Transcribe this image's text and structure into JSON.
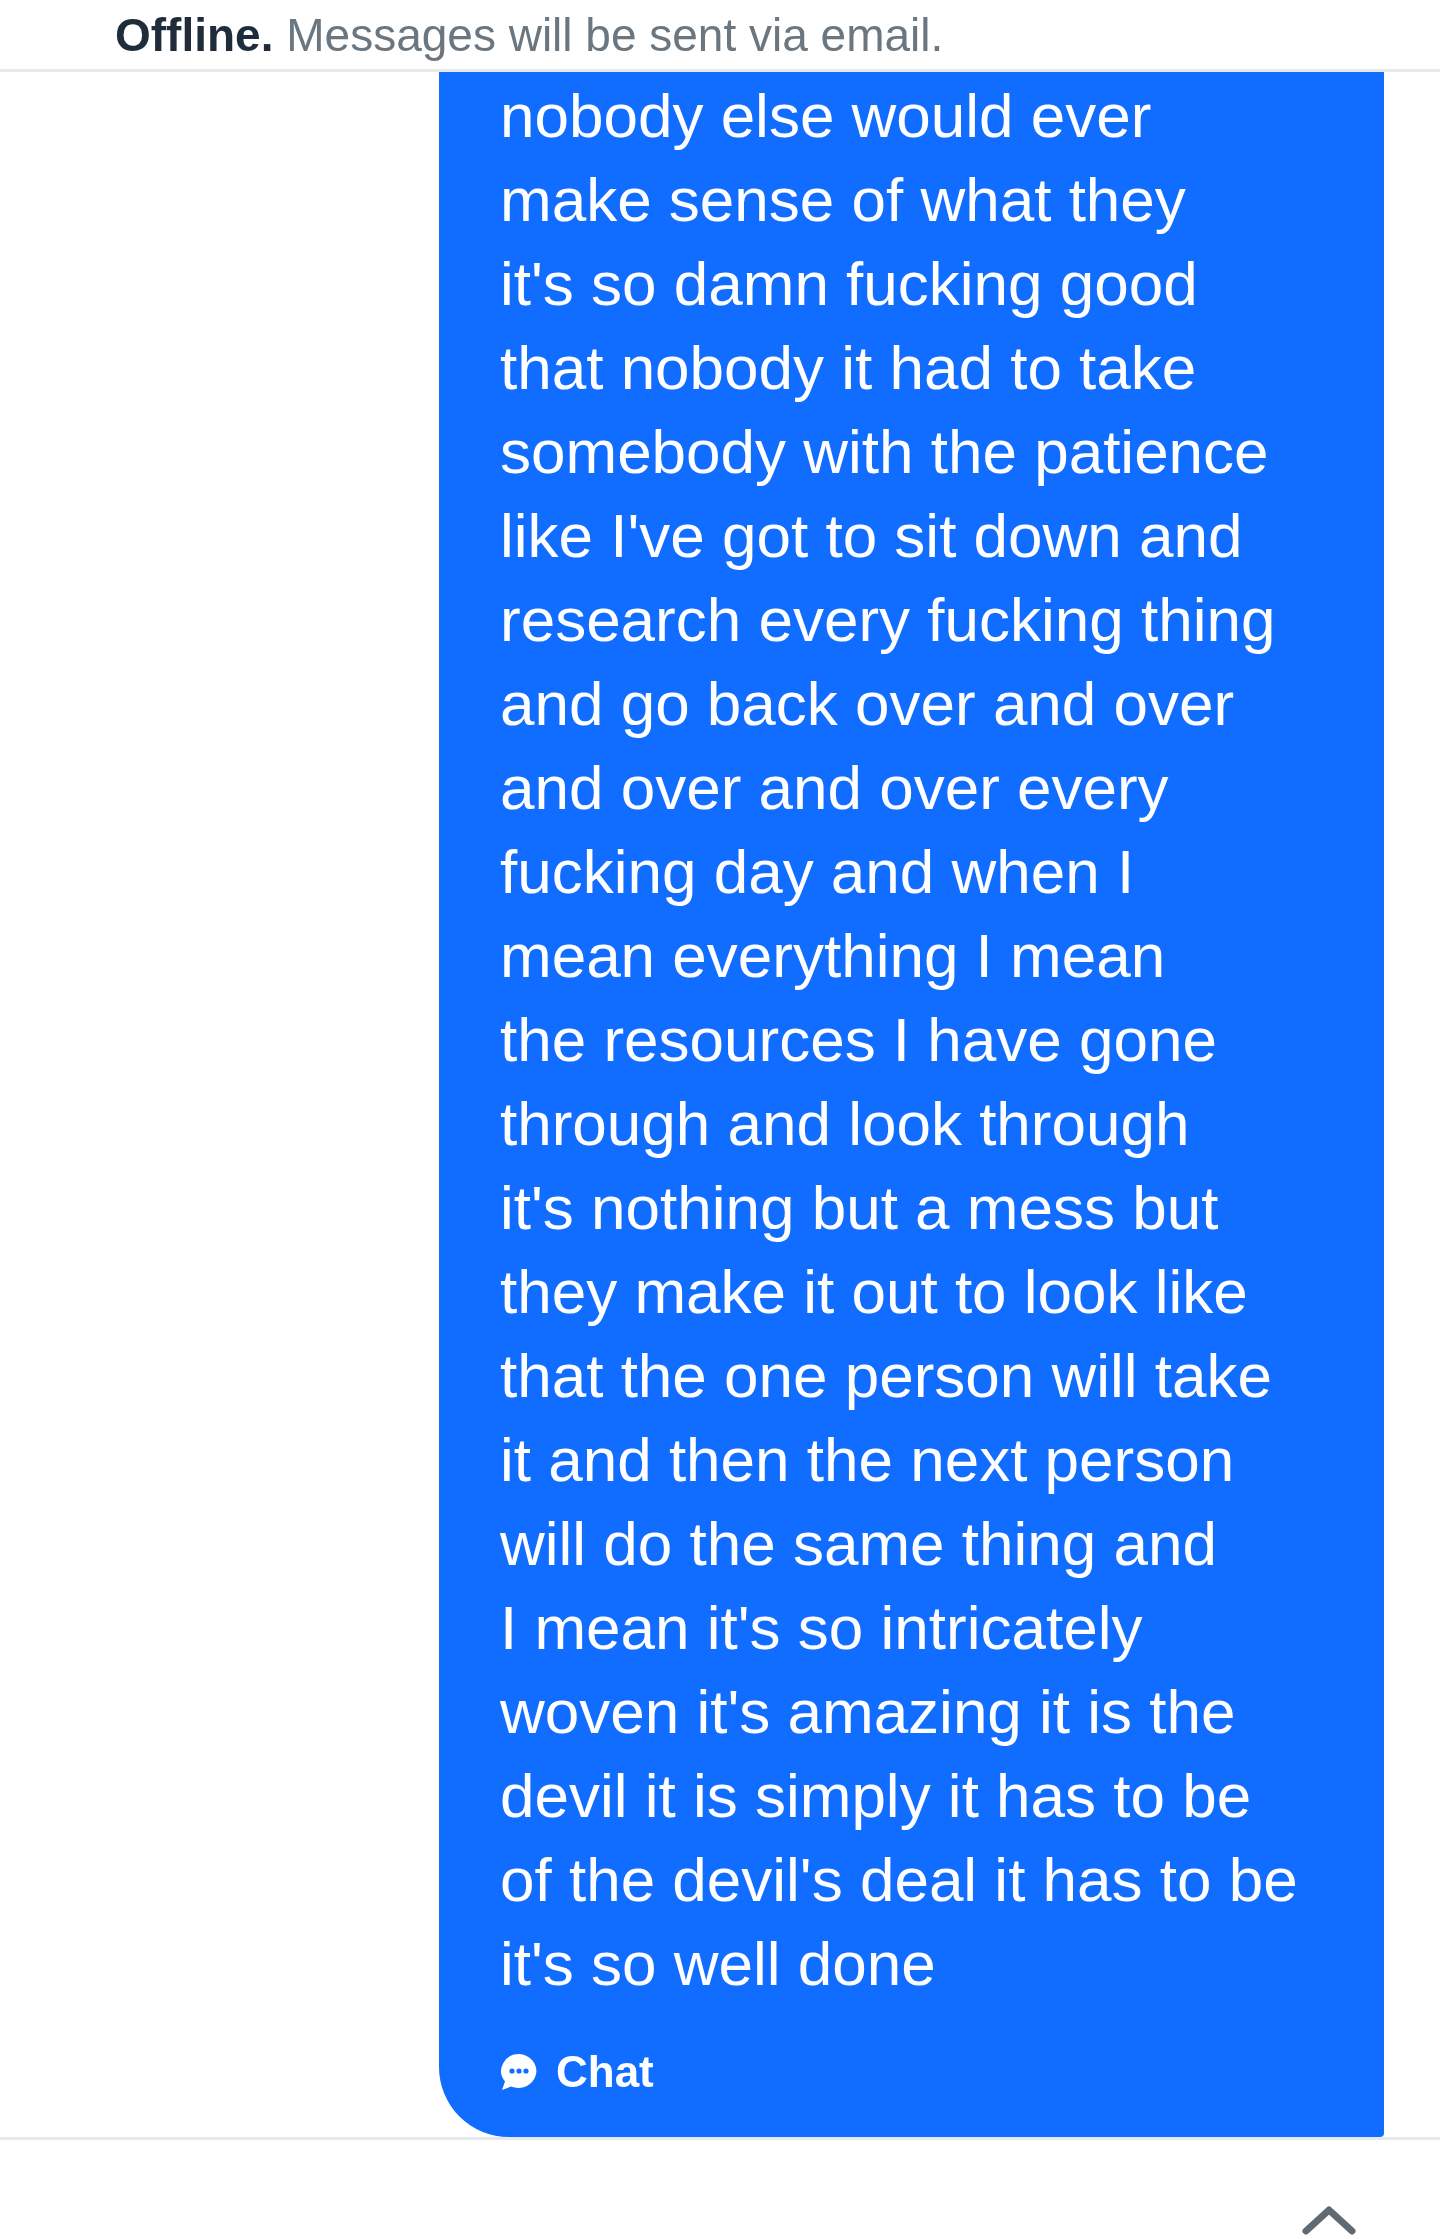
{
  "header": {
    "status": "**Offline.** Messages will be sent via email."
  },
  "message": {
    "text": "nobody else would ever\nmake sense of what they\nit's so damn fucking good\nthat nobody it had to take\nsomebody with the patience\nlike I've got to sit down and\nresearch every fucking thing\nand go back over and over\nand over and over every\nfucking day and when I\nmean everything I mean\nthe resources I have gone\nthrough and look through\nit's nothing but a mess but\nthey make it out to look like\nthat the one person will take\nit and then the next person\nwill do the same thing and\nI mean it's so intricately\nwoven it's amazing it is the\ndevil it is simply it has to be\nof the devil's deal it has to be\nit's so well done",
    "channel": "Chat"
  }
}
